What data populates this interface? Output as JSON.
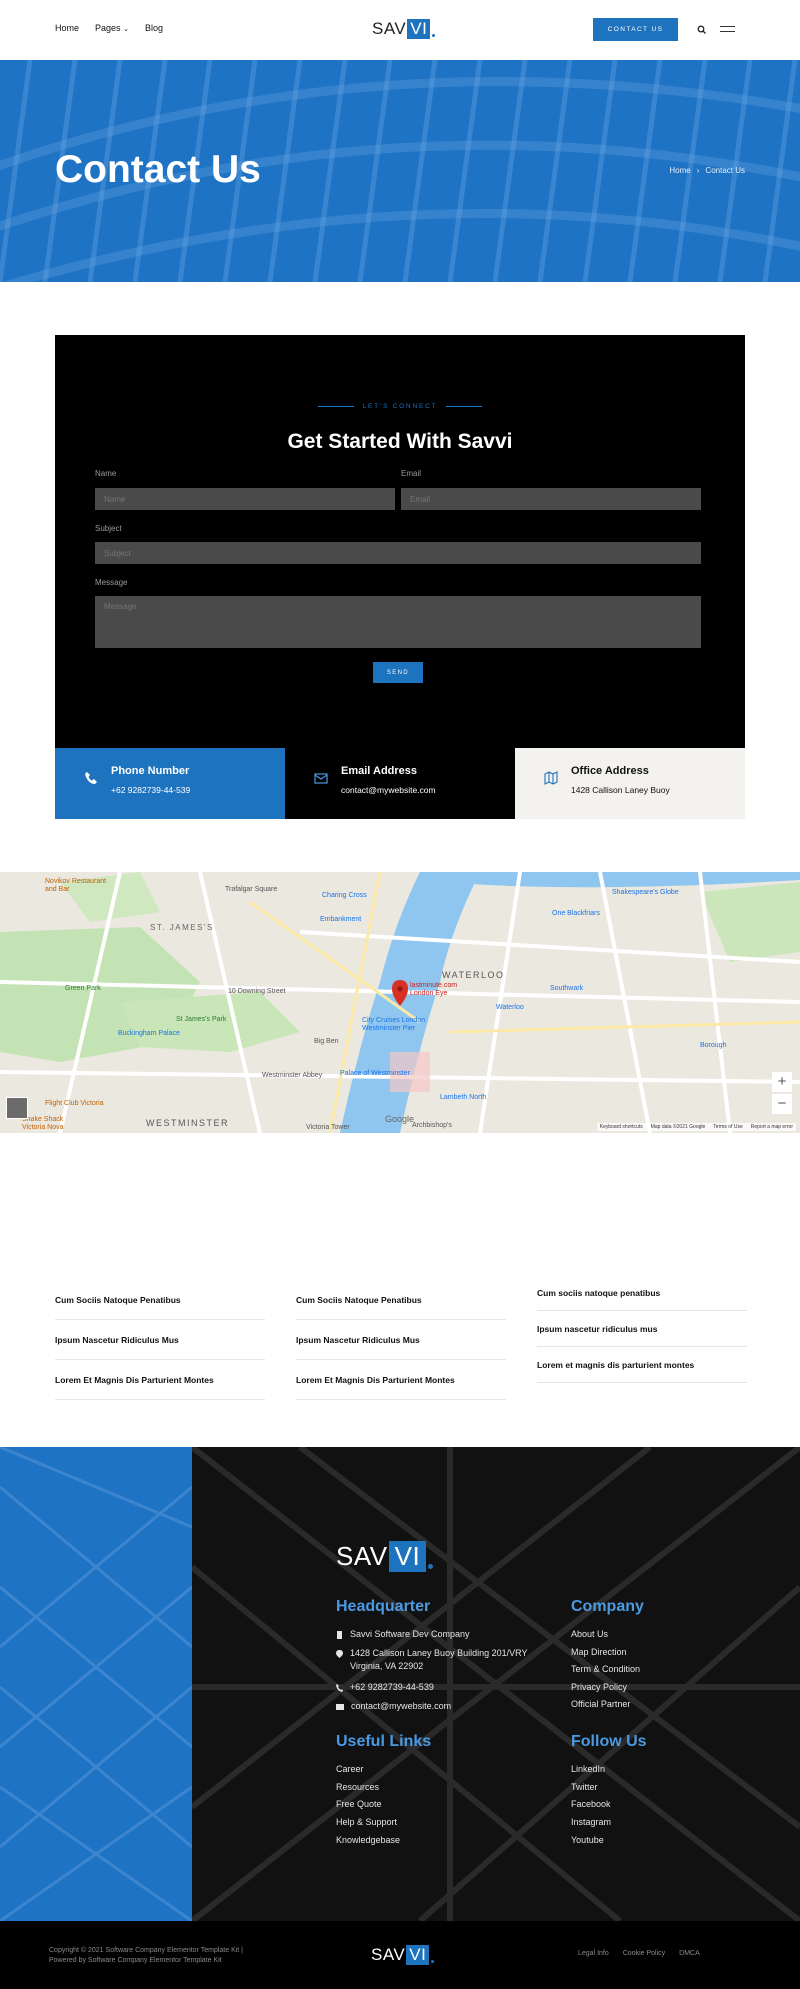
{
  "header": {
    "nav": [
      "Home",
      "Pages",
      "Blog"
    ],
    "logo": {
      "plain": "SAV",
      "box": "VI"
    },
    "contact_button": "CONTACT US"
  },
  "hero": {
    "title": "Contact Us",
    "breadcrumb": [
      "Home",
      "›",
      "Contact Us"
    ]
  },
  "contact_form": {
    "eyebrow": "LET'S CONNECT",
    "title": "Get Started With Savvi",
    "name_label": "Name",
    "name_placeholder": "Name",
    "email_label": "Email",
    "email_placeholder": "Email",
    "subject_label": "Subject",
    "subject_placeholder": "Subject",
    "message_label": "Message",
    "message_placeholder": "Message",
    "send_label": "SEND"
  },
  "info_cards": [
    {
      "title": "Phone Number",
      "value": "+62 9282739-44-539",
      "icon": "phone-icon",
      "bg": "#1e73be"
    },
    {
      "title": "Email Address",
      "value": "contact@mywebsite.com",
      "icon": "mail-icon",
      "bg": "#000000"
    },
    {
      "title": "Office Address",
      "value": "1428 Callison Laney Buoy",
      "icon": "map-icon",
      "bg": "#f4f2ee"
    }
  ],
  "map": {
    "labels": [
      "Trafalgar Square",
      "ST. JAMES'S",
      "WATERLOO",
      "WESTMINSTER",
      "Green Park",
      "Buckingham Palace",
      "St James's Park",
      "10 Downing Street",
      "Big Ben",
      "Westminster Abbey",
      "Palace of Westminster",
      "Lambeth North",
      "Waterloo",
      "Southwark",
      "One Blackfriars",
      "Shakespeare's Globe",
      "Charing Cross",
      "Embankment",
      "lastminute.com London Eye",
      "City Cruises London Westminster Pier",
      "Borough",
      "Novikov Restaurant and Bar",
      "Flight Club Victoria",
      "Shake Shack Victoria Nova",
      "Victoria Tower",
      "Archbishop's"
    ],
    "pin_label": "lastminute.com London Eye",
    "footer_text": [
      "Keyboard shortcuts",
      "Map data ©2021 Google",
      "Terms of Use",
      "Report a map error"
    ],
    "provider": "Google",
    "zoom_in": "+",
    "zoom_out": "−"
  },
  "links": [
    [
      "Cum Sociis Natoque Penatibus",
      "Ipsum Nascetur Ridiculus Mus",
      "Lorem Et Magnis Dis Parturient Montes"
    ],
    [
      "Cum Sociis Natoque Penatibus",
      "Ipsum Nascetur Ridiculus Mus",
      "Lorem Et Magnis Dis Parturient Montes"
    ],
    [
      "Cum sociis natoque penatibus",
      "Ipsum nascetur ridiculus mus",
      "Lorem et magnis dis parturient montes"
    ]
  ],
  "footer": {
    "logo": {
      "plain": "SAV",
      "box": "VI"
    },
    "headquarter": {
      "title": "Headquarter",
      "company": "Savvi Software Dev Company",
      "address_line1": "1428 Callison Laney Buoy Building 201/VRY",
      "address_line2": "Virginia, VA 22902",
      "phone": "+62 9282739-44-539",
      "email": "contact@mywebsite.com"
    },
    "company": {
      "title": "Company",
      "items": [
        "About Us",
        "Map Direction",
        "Term & Condition",
        "Privacy Policy",
        "Official Partner"
      ]
    },
    "useful_links": {
      "title": "Useful Links",
      "items": [
        "Career",
        "Resources",
        "Free Quote",
        "Help & Support",
        "Knowledgebase"
      ]
    },
    "follow_us": {
      "title": "Follow Us",
      "items": [
        "LinkedIn",
        "Twitter",
        "Facebook",
        "Instagram",
        "Youtube"
      ]
    }
  },
  "bottom_bar": {
    "copyright_line1": "Copyright © 2021 Software Company Elementor Template Kit |",
    "copyright_line2": "Powered by Software Company Elementor Template Kit",
    "logo": {
      "plain": "SAV",
      "box": "VI"
    },
    "links": [
      "Legal Info",
      "Cookie Policy",
      "DMCA"
    ]
  },
  "colors": {
    "accent": "#1e73be",
    "footer_heading": "#4a9ae3",
    "map_pin": "#d93025"
  }
}
